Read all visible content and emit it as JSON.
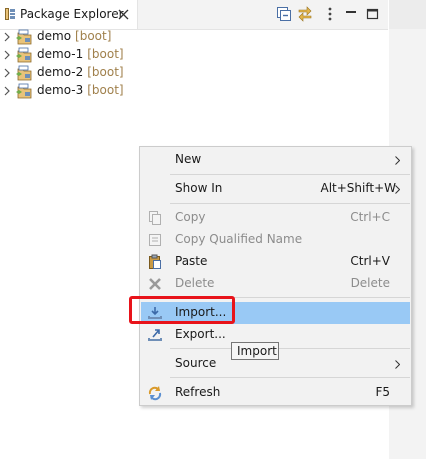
{
  "view": {
    "tab_title": "Package Explorer",
    "tab_icon": "package-explorer-icon",
    "close_icon": "close-icon",
    "toolbar": [
      {
        "name": "collapse-all-icon"
      },
      {
        "name": "link-with-editor-icon"
      },
      {
        "name": "view-menu-icon"
      },
      {
        "name": "minimize-icon"
      },
      {
        "name": "maximize-icon"
      }
    ]
  },
  "tree": {
    "projects": [
      {
        "name": "demo",
        "tag": "[boot]"
      },
      {
        "name": "demo-1",
        "tag": "[boot]"
      },
      {
        "name": "demo-2",
        "tag": "[boot]"
      },
      {
        "name": "demo-3",
        "tag": "[boot]"
      }
    ]
  },
  "context_menu": {
    "items": [
      {
        "label": "New",
        "accelerator": "",
        "submenu": true,
        "enabled": true,
        "icon": ""
      },
      {
        "label": "Show In",
        "accelerator": "Alt+Shift+W",
        "submenu": true,
        "enabled": true,
        "icon": ""
      },
      {
        "label": "Copy",
        "accelerator": "Ctrl+C",
        "submenu": false,
        "enabled": false,
        "icon": "copy-icon"
      },
      {
        "label": "Copy Qualified Name",
        "accelerator": "",
        "submenu": false,
        "enabled": false,
        "icon": "copy-qualified-name-icon"
      },
      {
        "label": "Paste",
        "accelerator": "Ctrl+V",
        "submenu": false,
        "enabled": true,
        "icon": "paste-icon"
      },
      {
        "label": "Delete",
        "accelerator": "Delete",
        "submenu": false,
        "enabled": false,
        "icon": "delete-icon"
      },
      {
        "label": "Import...",
        "accelerator": "",
        "submenu": false,
        "enabled": true,
        "icon": "import-icon",
        "selected": true
      },
      {
        "label": "Export...",
        "accelerator": "",
        "submenu": false,
        "enabled": true,
        "icon": "export-icon"
      },
      {
        "label": "Source",
        "accelerator": "",
        "submenu": true,
        "enabled": true,
        "icon": ""
      },
      {
        "label": "Refresh",
        "accelerator": "F5",
        "submenu": false,
        "enabled": true,
        "icon": "refresh-icon"
      }
    ],
    "tooltip": "Import"
  },
  "colors": {
    "selection": "#99c9f5",
    "highlight_box": "#e8131a",
    "boot_tag": "#a0804c",
    "disabled_text": "#8c8c8c"
  }
}
